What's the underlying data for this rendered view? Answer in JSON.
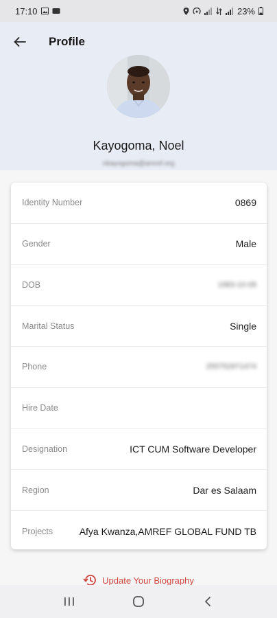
{
  "status_bar": {
    "time": "17:10",
    "battery": "23%"
  },
  "header": {
    "title": "Profile",
    "name": "Kayogoma, Noel",
    "email": "nkayogoma@amref.org"
  },
  "profile_rows": [
    {
      "label": "Identity Number",
      "value": "0869"
    },
    {
      "label": "Gender",
      "value": "Male"
    },
    {
      "label": "DOB",
      "value": "1983-10-08"
    },
    {
      "label": "Marital Status",
      "value": "Single"
    },
    {
      "label": "Phone",
      "value": "255752971474"
    },
    {
      "label": "Hire Date",
      "value": ""
    },
    {
      "label": "Designation",
      "value": "ICT CUM Software Developer"
    },
    {
      "label": "Region",
      "value": "Dar es Salaam"
    },
    {
      "label": "Projects",
      "value": "Afya Kwanza,AMREF GLOBAL FUND TB"
    }
  ],
  "actions": {
    "update_biography": "Update Your Biography"
  },
  "colors": {
    "header_bg": "#e8edf5",
    "accent_red": "#d0453f"
  }
}
